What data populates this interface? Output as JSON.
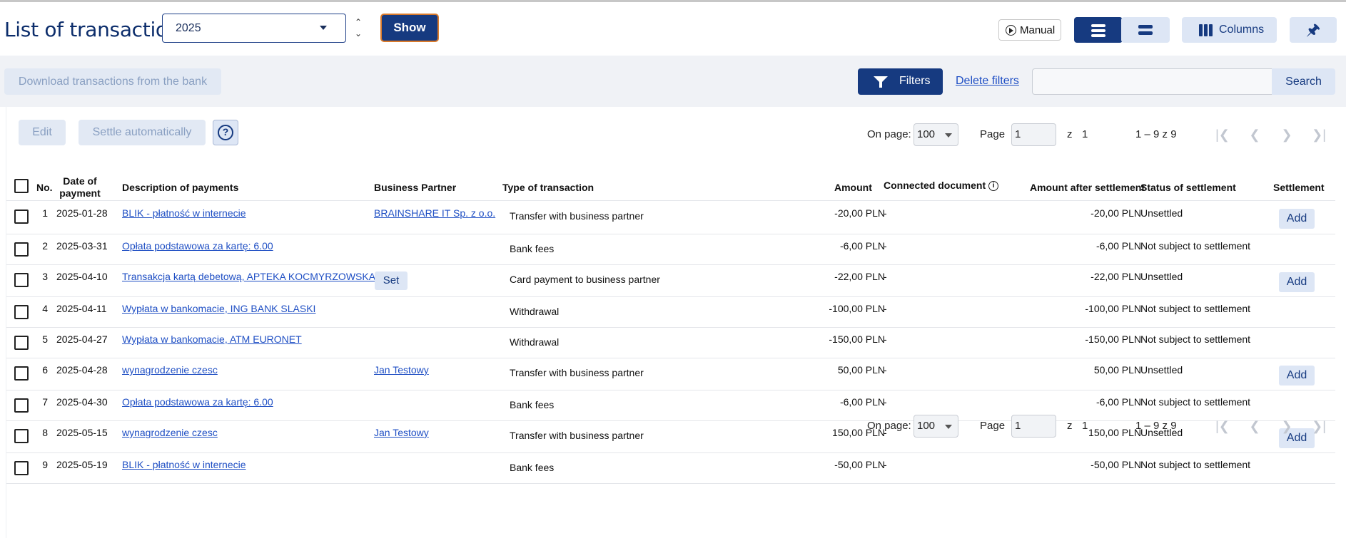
{
  "header": {
    "title": "List of transactions",
    "year_value": "2025",
    "show_label": "Show",
    "manual_label": "Manual",
    "columns_label": "Columns"
  },
  "toolbar": {
    "download_label": "Download transactions from the bank",
    "filters_label": "Filters",
    "delete_filters_label": "Delete filters",
    "search_value": "",
    "search_label": "Search"
  },
  "actions": {
    "edit_label": "Edit",
    "settle_label": "Settle automatically",
    "help_glyph": "?"
  },
  "pager": {
    "on_page_label": "On page:",
    "per_page": "100",
    "page_label": "Page",
    "page_value": "1",
    "of_label": "z",
    "total_pages": "1",
    "range": "1 – 9 z 9"
  },
  "table": {
    "columns": {
      "no": "No.",
      "date_l1": "Date of",
      "date_l2": "payment",
      "description": "Description of payments",
      "partner": "Business Partner",
      "type": "Type of transaction",
      "amount": "Amount",
      "connected": "Connected document",
      "after": "Amount after settlement",
      "status": "Status of settlement",
      "settlement": "Settlement"
    },
    "rows": [
      {
        "no": "1",
        "date": "2025-01-28",
        "desc": "BLIK - płatność w internecie",
        "partner": "BRAINSHARE IT Sp. z o.o.",
        "set": "",
        "type": "Transfer with business partner",
        "amount": "-20,00 PLN",
        "doc": "-",
        "after": "-20,00 PLN",
        "status": "Unsettled",
        "action": "Add"
      },
      {
        "no": "2",
        "date": "2025-03-31",
        "desc": "Opłata podstawowa za kartę: 6.00",
        "partner": "",
        "set": "",
        "type": "Bank fees",
        "amount": "-6,00 PLN",
        "doc": "-",
        "after": "-6,00 PLN",
        "status": "Not subject to settlement",
        "action": ""
      },
      {
        "no": "3",
        "date": "2025-04-10",
        "desc": "Transakcja kartą debetową, APTEKA KOCMYRZOWSKA",
        "partner": "",
        "set": "Set",
        "type": "Card payment to business partner",
        "amount": "-22,00 PLN",
        "doc": "-",
        "after": "-22,00 PLN",
        "status": "Unsettled",
        "action": "Add"
      },
      {
        "no": "4",
        "date": "2025-04-11",
        "desc": "Wypłata w bankomacie, ING BANK SLASKI",
        "partner": "",
        "set": "",
        "type": "Withdrawal",
        "amount": "-100,00 PLN",
        "doc": "-",
        "after": "-100,00 PLN",
        "status": "Not subject to settlement",
        "action": ""
      },
      {
        "no": "5",
        "date": "2025-04-27",
        "desc": "Wypłata w bankomacie, ATM EURONET",
        "partner": "",
        "set": "",
        "type": "Withdrawal",
        "amount": "-150,00 PLN",
        "doc": "-",
        "after": "-150,00 PLN",
        "status": "Not subject to settlement",
        "action": ""
      },
      {
        "no": "6",
        "date": "2025-04-28",
        "desc": "wynagrodzenie czesc",
        "partner": "Jan Testowy",
        "set": "",
        "type": "Transfer with business partner",
        "amount": "50,00 PLN",
        "doc": "-",
        "after": "50,00 PLN",
        "status": "Unsettled",
        "action": "Add"
      },
      {
        "no": "7",
        "date": "2025-04-30",
        "desc": "Opłata podstawowa za kartę: 6.00",
        "partner": "",
        "set": "",
        "type": "Bank fees",
        "amount": "-6,00 PLN",
        "doc": "-",
        "after": "-6,00 PLN",
        "status": "Not subject to settlement",
        "action": ""
      },
      {
        "no": "8",
        "date": "2025-05-15",
        "desc": "wynagrodzenie czesc",
        "partner": "Jan Testowy",
        "set": "",
        "type": "Transfer with business partner",
        "amount": "150,00 PLN",
        "doc": "-",
        "after": "150,00 PLN",
        "status": "Unsettled",
        "action": "Add"
      },
      {
        "no": "9",
        "date": "2025-05-19",
        "desc": "BLIK - płatność w internecie",
        "partner": "",
        "set": "",
        "type": "Bank fees",
        "amount": "-50,00 PLN",
        "doc": "-",
        "after": "-50,00 PLN",
        "status": "Not subject to settlement",
        "action": ""
      }
    ]
  },
  "colors": {
    "brand_navy": "#163a80",
    "light_button": "#dde6f5",
    "link": "#1f4fc4"
  }
}
